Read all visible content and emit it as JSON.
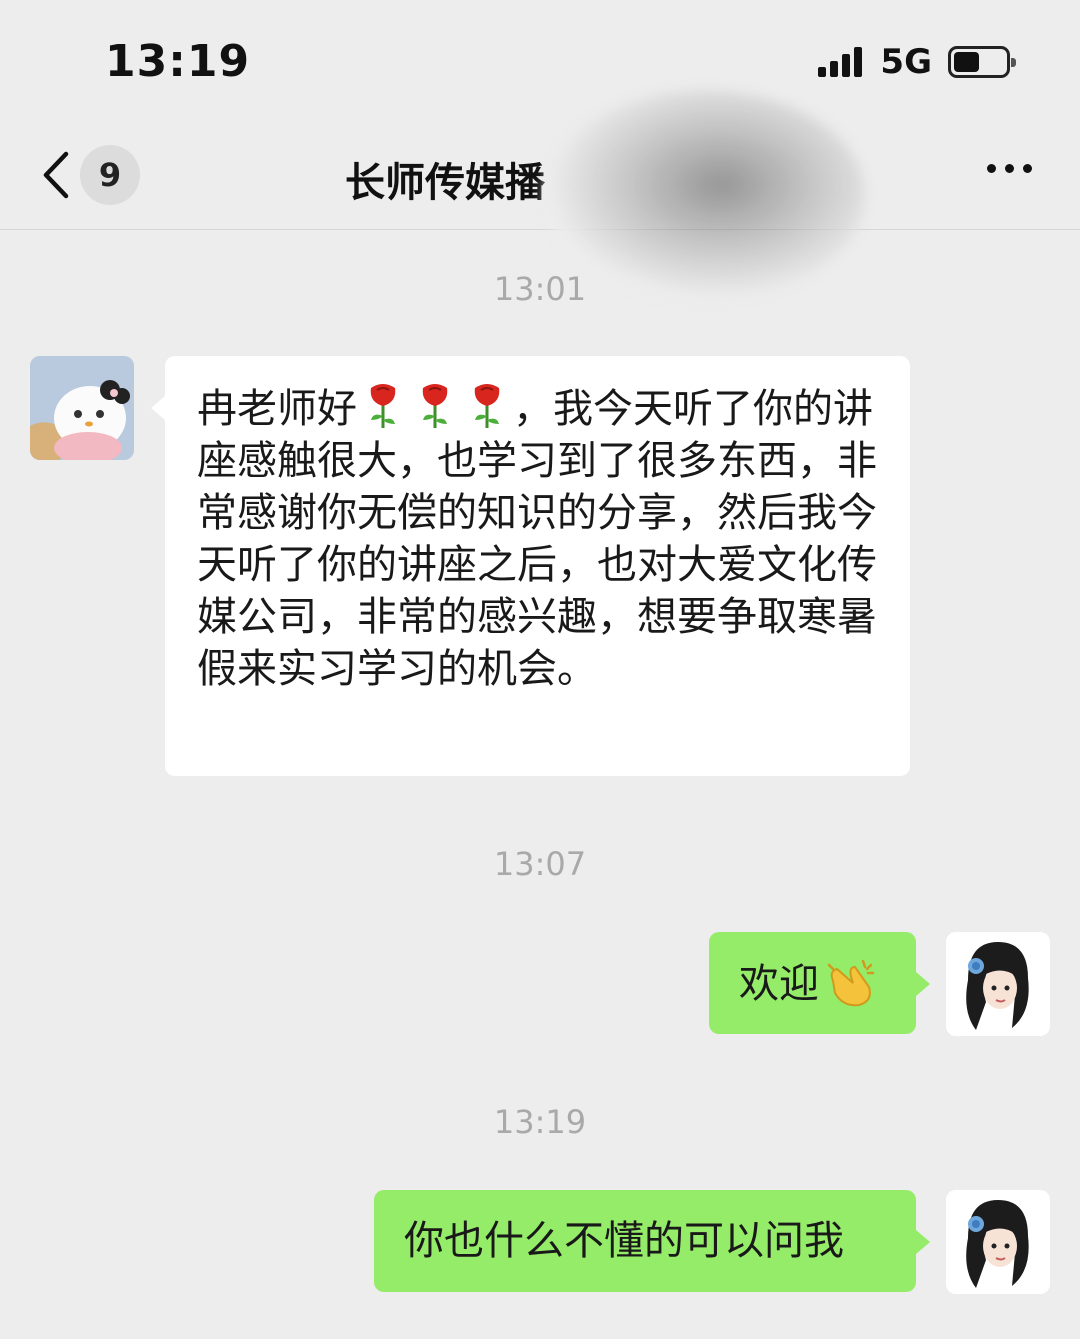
{
  "status_bar": {
    "time": "13:19",
    "network": "5G",
    "battery_level": 0.5
  },
  "nav": {
    "unread_count": "9",
    "title": "长师传媒播"
  },
  "messages": [
    {
      "timestamp": "13:01",
      "side": "left",
      "text_before": "冉老师好",
      "emoji": "rose",
      "text_after": "，我今天听了你的讲座感触很大，也学习到了很多东西，非常感谢你无偿的知识的分享，然后我今天听了你的讲座之后，也对大爱文化传媒公司，非常的感兴趣，想要争取寒暑假来实习学习的机会。"
    },
    {
      "timestamp": "13:07",
      "side": "right",
      "text": "欢迎",
      "emoji": "clapping-hands"
    },
    {
      "timestamp": "13:19",
      "side": "right",
      "text": "你也什么不懂的可以问我"
    }
  ],
  "colors": {
    "background": "#ededed",
    "incoming_bubble": "#ffffff",
    "outgoing_bubble": "#95ec69",
    "timestamp": "#a9a9a9"
  }
}
